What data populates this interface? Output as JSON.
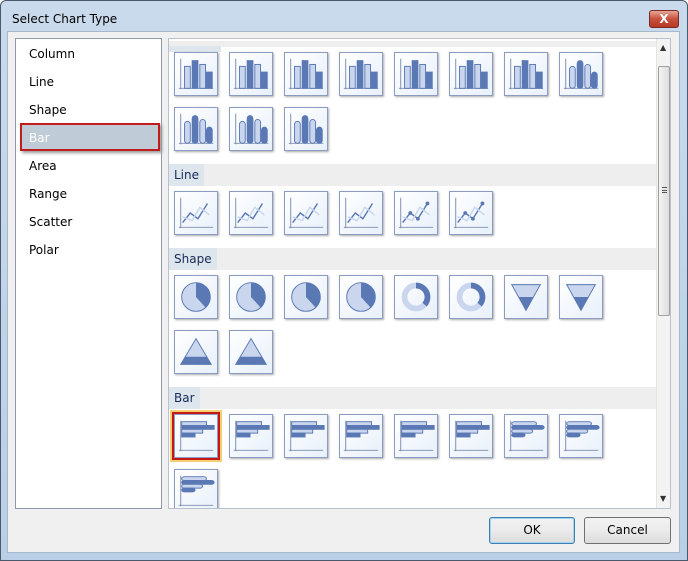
{
  "window": {
    "title": "Select Chart Type",
    "close_glyph": "X"
  },
  "categories": [
    {
      "label": "Column"
    },
    {
      "label": "Line"
    },
    {
      "label": "Shape"
    },
    {
      "label": "Bar",
      "selected": true
    },
    {
      "label": "Area"
    },
    {
      "label": "Range"
    },
    {
      "label": "Scatter"
    },
    {
      "label": "Polar"
    }
  ],
  "gallery": {
    "sections": [
      {
        "label": "",
        "icons": [
          "column-clustered",
          "column-stacked",
          "column-stacked-100",
          "column-3d-clustered",
          "column-3d-stacked",
          "column-3d-stacked-100",
          "column-3d",
          "cylinder-clustered",
          "cylinder-stacked",
          "cylinder-stacked-100",
          "cylinder-3d"
        ]
      },
      {
        "label": "Line",
        "icons": [
          "line",
          "smooth-line",
          "stepped-line",
          "line-3d",
          "line-markers",
          "smooth-line-markers"
        ]
      },
      {
        "label": "Shape",
        "icons": [
          "pie",
          "exploded-pie",
          "pie-3d",
          "exploded-pie-3d",
          "doughnut",
          "exploded-doughnut",
          "funnel",
          "funnel-3d",
          "pyramid",
          "pyramid-3d"
        ]
      },
      {
        "label": "Bar",
        "icons": [
          "bar-clustered",
          "bar-stacked",
          "bar-stacked-100",
          "bar-3d-clustered",
          "bar-3d-stacked",
          "bar-3d",
          "bar-cylinder-clustered",
          "bar-cylinder-stacked",
          "bar-cylinder-3d"
        ],
        "selected_index": 0
      }
    ]
  },
  "buttons": {
    "ok": "OK",
    "cancel": "Cancel"
  },
  "colors": {
    "accent": "#4f6fa8",
    "selection_border": "#c11c1c",
    "highlight": "#f7cf70"
  }
}
